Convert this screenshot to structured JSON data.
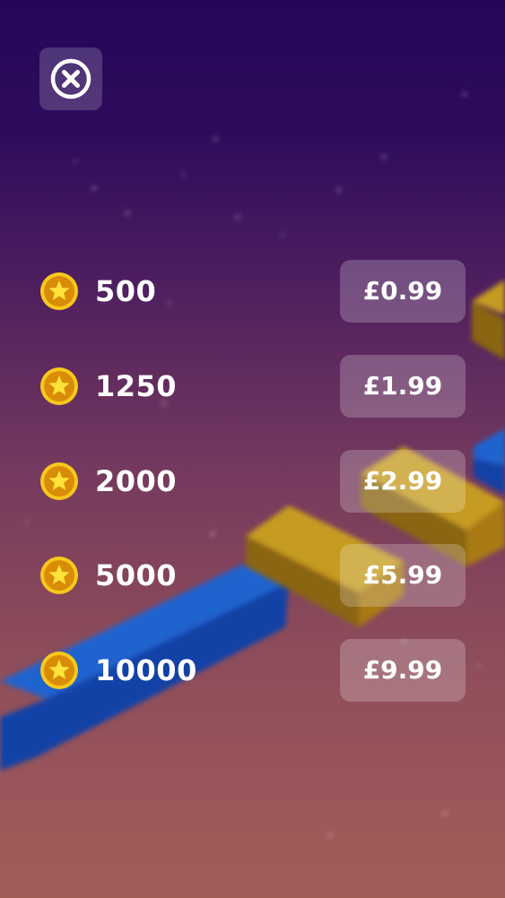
{
  "close_button": {
    "icon": "close-circle-icon"
  },
  "offers": [
    {
      "amount": "500",
      "price": "£0.99",
      "icon": "star-coin-icon"
    },
    {
      "amount": "1250",
      "price": "£1.99",
      "icon": "star-coin-icon"
    },
    {
      "amount": "2000",
      "price": "£2.99",
      "icon": "star-coin-icon"
    },
    {
      "amount": "5000",
      "price": "£5.99",
      "icon": "star-coin-icon"
    },
    {
      "amount": "10000",
      "price": "£9.99",
      "icon": "star-coin-icon"
    }
  ],
  "colors": {
    "coin_outer": "#f8c81c",
    "coin_inner": "#d88c08",
    "star": "#ffe23a",
    "block_blue": "#1b4fb0",
    "block_gold": "#b58a18"
  }
}
